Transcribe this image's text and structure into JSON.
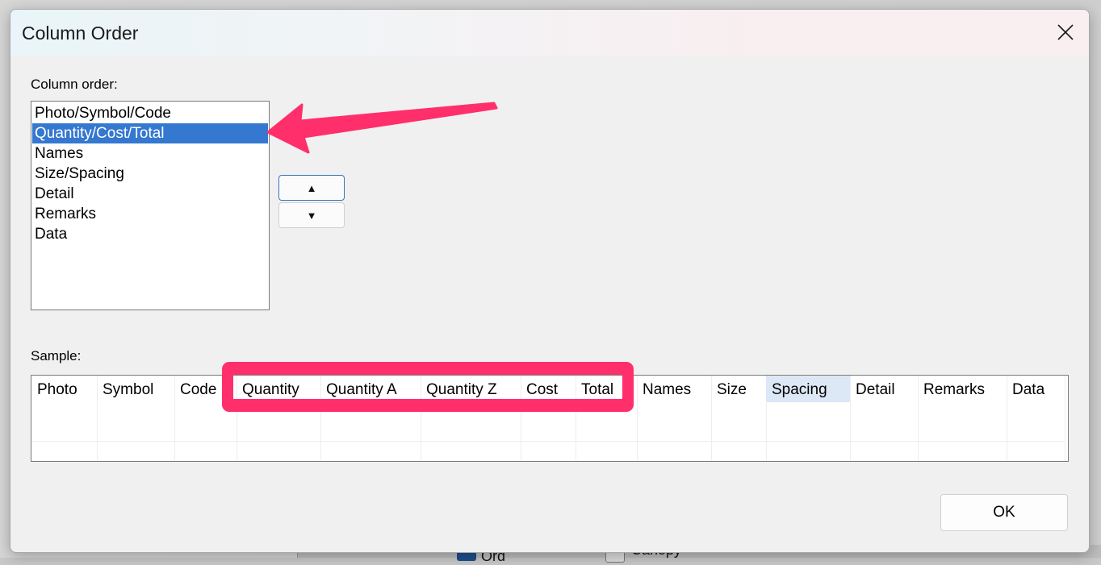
{
  "dialog": {
    "title": "Column Order",
    "close_icon": "close-icon",
    "column_order_label": "Column order:",
    "column_order_items": [
      {
        "label": "Photo/Symbol/Code",
        "selected": false
      },
      {
        "label": "Quantity/Cost/Total",
        "selected": true
      },
      {
        "label": "Names",
        "selected": false
      },
      {
        "label": "Size/Spacing",
        "selected": false
      },
      {
        "label": "Detail",
        "selected": false
      },
      {
        "label": "Remarks",
        "selected": false
      },
      {
        "label": "Data",
        "selected": false
      }
    ],
    "move_up_label": "▲",
    "move_down_label": "▼",
    "sample_label": "Sample:",
    "sample_columns": [
      "Photo",
      "Symbol",
      "Code",
      "Quantity",
      "Quantity A",
      "Quantity Z",
      "Cost",
      "Total",
      "Names",
      "Size",
      "Spacing",
      "Detail",
      "Remarks",
      "Data"
    ],
    "sample_highlighted_column": "Spacing",
    "ok_label": "OK"
  },
  "annotations": {
    "color": "#ff2f6b",
    "arrow_target": "Quantity/Cost/Total",
    "highlight_box_columns": [
      "Quantity",
      "Quantity A",
      "Quantity Z",
      "Cost",
      "Total"
    ]
  },
  "background": {
    "text_fragment_1": "Ord",
    "text_fragment_2": "Canopy"
  },
  "colors": {
    "selection": "#3478d0",
    "highlight_cell": "#dce8f6",
    "annotation": "#ff2f6b"
  }
}
